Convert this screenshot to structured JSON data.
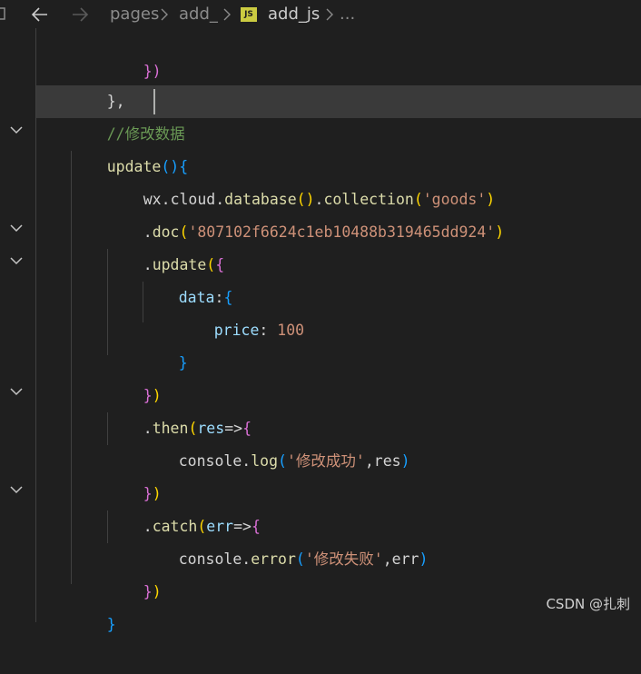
{
  "breadcrumb": {
    "items": [
      "pages",
      "add_",
      "add_js",
      "..."
    ],
    "file_badge": "JS"
  },
  "code": {
    "l0": {
      "a": "})"
    },
    "l1": {
      "a": "},"
    },
    "l2": {
      "a": "//修改数据"
    },
    "l3": {
      "a": "update",
      "b": "(",
      "c": ")",
      "d": "{"
    },
    "l4": {
      "a": "wx",
      "b": ".",
      "c": "cloud",
      "d": ".",
      "e": "database",
      "f": "()",
      "g": ".",
      "h": "collection",
      "i": "(",
      "j": "'goods'",
      "k": ")"
    },
    "l5": {
      "a": ".",
      "b": "doc",
      "c": "(",
      "d": "'807102f6624c1eb10488b319465dd924'",
      "e": ")"
    },
    "l6": {
      "a": ".",
      "b": "update",
      "c": "(",
      "d": "{"
    },
    "l7": {
      "a": "data",
      "b": ":",
      "c": "{"
    },
    "l8": {
      "a": "price",
      "b": ": ",
      "c": "100"
    },
    "l9": {
      "a": "}"
    },
    "l10": {
      "a": "}",
      "b": ")"
    },
    "l11": {
      "a": ".",
      "b": "then",
      "c": "(",
      "d": "res",
      "e": "=>",
      "f": "{"
    },
    "l12": {
      "a": "console",
      "b": ".",
      "c": "log",
      "d": "(",
      "e": "'修改成功'",
      "f": ",",
      "g": "res",
      "h": ")"
    },
    "l13": {
      "a": "}",
      "b": ")"
    },
    "l14": {
      "a": ".",
      "b": "catch",
      "c": "(",
      "d": "err",
      "e": "=>",
      "f": "{"
    },
    "l15": {
      "a": "console",
      "b": ".",
      "c": "error",
      "d": "(",
      "e": "'修改失败'",
      "f": ",",
      "g": "err",
      "h": ")"
    },
    "l16": {
      "a": "}",
      "b": ")"
    },
    "l17": {
      "a": "}"
    }
  },
  "watermark": "CSDN @扎刺",
  "icons": {
    "back": "arrow-left-icon",
    "forward": "arrow-right-icon",
    "separator": "chevron-right-icon",
    "fold": "chevron-down-icon"
  },
  "colors": {
    "background": "#1f1f1f",
    "function": "#dcdcaa",
    "string": "#ce9178",
    "number": "#b5cea8",
    "property": "#9cdcfe",
    "comment": "#6a9955",
    "bracket_gold": "#ffd700",
    "bracket_orchid": "#da70d6",
    "bracket_blue": "#179fff"
  }
}
